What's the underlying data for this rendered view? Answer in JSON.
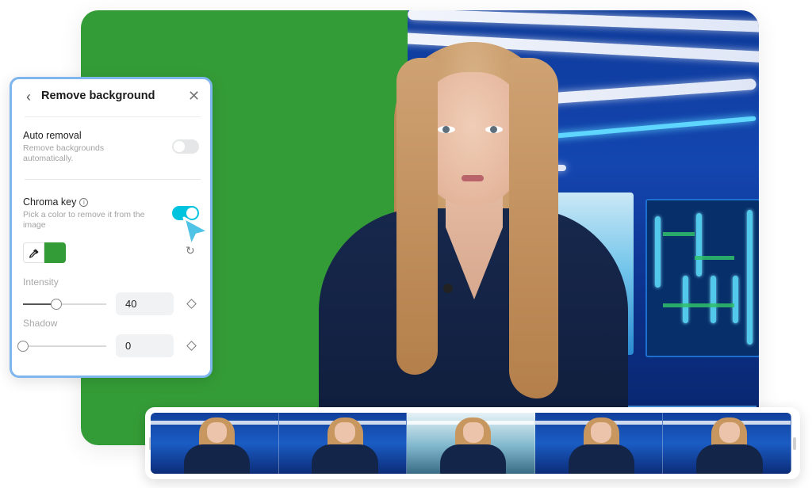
{
  "canvas": {
    "background_left_color": "#349c37",
    "background_right_description": "news studio background",
    "subject_description": "news presenter"
  },
  "panel": {
    "title": "Remove background",
    "back_icon": "chevron-left-icon",
    "close_icon": "close-icon",
    "auto_removal": {
      "title": "Auto removal",
      "description": "Remove backgrounds automatically.",
      "enabled": false
    },
    "chroma_key": {
      "title": "Chroma key",
      "info_icon": "info-icon",
      "description": "Pick a color to remove it from the image",
      "enabled": true,
      "picked_color": "#349c37",
      "eyedropper_icon": "eyedropper-icon",
      "reset_icon": "reset-icon"
    },
    "intensity": {
      "label": "Intensity",
      "value": "40",
      "slider_fraction": 0.4
    },
    "shadow": {
      "label": "Shadow",
      "value": "0",
      "slider_fraction": 0
    },
    "keyframe_icon": "diamond-icon",
    "accent_color": "#00c4dd",
    "border_color": "#7fb6ee"
  },
  "filmstrip": {
    "frames": [
      {
        "type": "studio"
      },
      {
        "type": "studio"
      },
      {
        "type": "city"
      },
      {
        "type": "studio"
      },
      {
        "type": "studio"
      }
    ]
  }
}
